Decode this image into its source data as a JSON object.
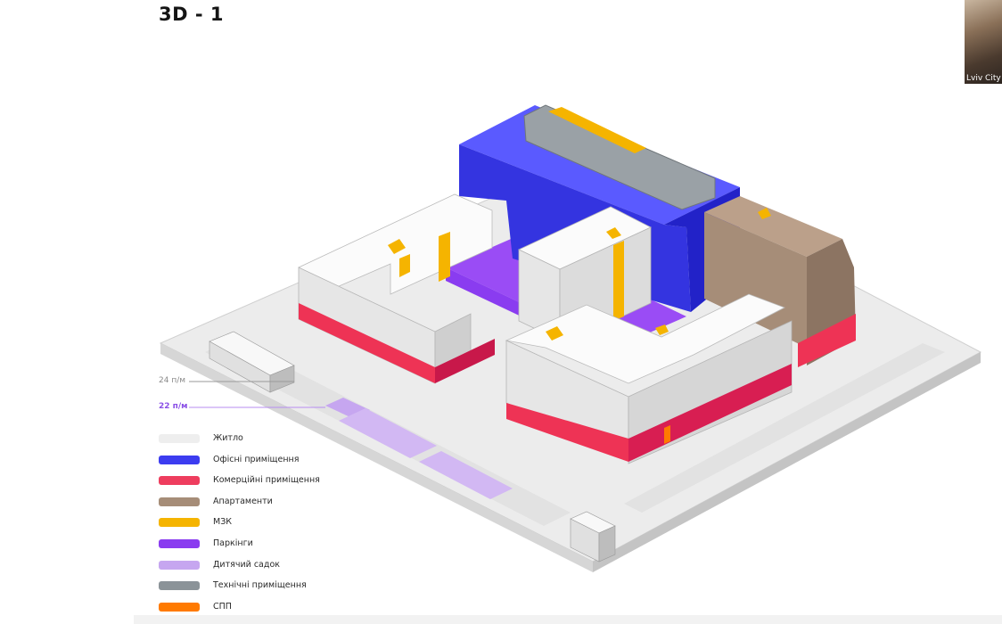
{
  "slide": {
    "title": "3D - 1",
    "thumbnail_label": "Lviv City"
  },
  "levels": {
    "l24": "24 п/м",
    "l22": "22 п/м"
  },
  "legend": {
    "items": [
      {
        "label": "Житло",
        "color": "#eeeeee"
      },
      {
        "label": "Офісні приміщення",
        "color": "#3c3cf0"
      },
      {
        "label": "Комерційні приміщення",
        "color": "#ee3d5e"
      },
      {
        "label": "Апартаменти",
        "color": "#a68d78"
      },
      {
        "label": "МЗК",
        "color": "#f5b400"
      },
      {
        "label": "Паркінги",
        "color": "#8a3cf0"
      },
      {
        "label": "Дитячий садок",
        "color": "#c6a6f0"
      },
      {
        "label": "Технічні приміщення",
        "color": "#8b9398"
      },
      {
        "label": "СПП",
        "color": "#ff7a00"
      }
    ]
  },
  "colors": {
    "residential_top": "#ffffff",
    "residential_left": "#e4e4e4",
    "residential_right": "#cfcfcf",
    "office_top": "#5a5aff",
    "office_left": "#3737e6",
    "office_right": "#2a2ad0",
    "commercial_left": "#ee3355",
    "commercial_right": "#c8184a",
    "apartment_top": "#bba08a",
    "apartment_left": "#a68d78",
    "apartment_right": "#8c7462",
    "parking": "#9a4cf5",
    "technical": "#9aa1a6",
    "mzk": "#f5b400",
    "ground_top": "#eeeeee",
    "ground_edge": "#d2d2d2"
  }
}
